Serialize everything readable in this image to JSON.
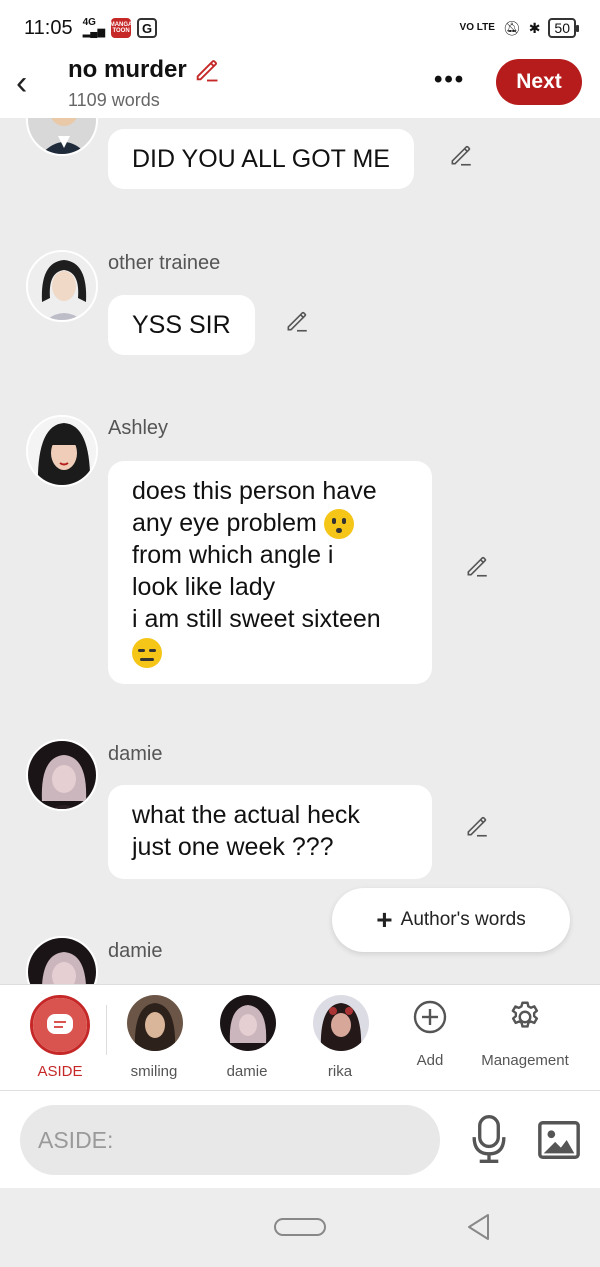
{
  "status_bar": {
    "time": "11:05",
    "network": "4G",
    "battery": "50",
    "lte_label": "VO LTE"
  },
  "header": {
    "title": "no murder",
    "word_count": "1109 words",
    "next_label": "Next",
    "more_label": "•••"
  },
  "messages": [
    {
      "speaker": "",
      "text": "DID YOU ALL GOT ME"
    },
    {
      "speaker": "other trainee",
      "text": "YSS SIR"
    },
    {
      "speaker": "Ashley",
      "lines": [
        "does this person have",
        "any eye problem",
        "from which angle i",
        "look like lady",
        "i am still sweet sixteen"
      ]
    },
    {
      "speaker": "damie",
      "lines": [
        "what the actual heck",
        "just one week ???"
      ]
    },
    {
      "speaker": "damie",
      "text": ""
    }
  ],
  "authors_words_label": "Author's words",
  "character_bar": {
    "items": [
      {
        "label": "ASIDE",
        "color": "#c62828"
      },
      {
        "label": "smiling"
      },
      {
        "label": "damie"
      },
      {
        "label": "rika"
      },
      {
        "label": "Add"
      },
      {
        "label": "Management"
      }
    ]
  },
  "input": {
    "placeholder": "ASIDE:"
  },
  "colors": {
    "accent": "#b71c1c",
    "background": "#ececec"
  }
}
